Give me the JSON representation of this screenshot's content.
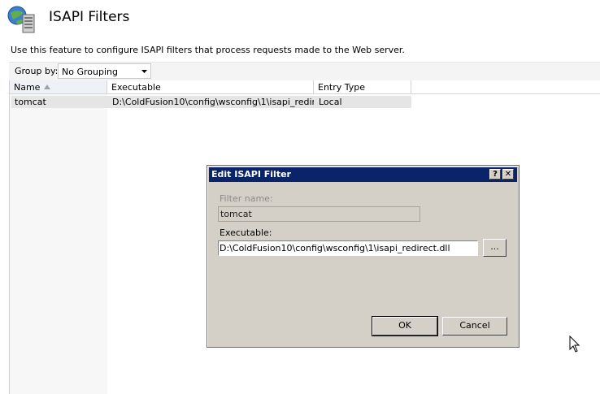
{
  "header": {
    "title": "ISAPI Filters",
    "description": "Use this feature to configure ISAPI filters that process requests made to the Web server.",
    "icon": "iis-filter-icon"
  },
  "groupby": {
    "label": "Group by:",
    "value": "No Grouping"
  },
  "list": {
    "columns": [
      "Name",
      "Executable",
      "Entry Type"
    ],
    "sorted_column": "Name",
    "rows": [
      {
        "name": "tomcat",
        "executable": "D:\\ColdFusion10\\config\\wsconfig\\1\\isapi_redire…",
        "entry_type": "Local"
      }
    ]
  },
  "dialog": {
    "title": "Edit ISAPI Filter",
    "help_label": "?",
    "close_label": "✕",
    "filter_name_label": "Filter name:",
    "filter_name_value": "tomcat",
    "executable_label": "Executable:",
    "executable_value": "D:\\ColdFusion10\\config\\wsconfig\\1\\isapi_redirect.dll",
    "browse_label": "...",
    "ok_label": "OK",
    "cancel_label": "Cancel"
  },
  "colors": {
    "titlebar": "#0a246a",
    "dialog_bg": "#d4d0c8",
    "selected_row": "#e5e5e5"
  }
}
